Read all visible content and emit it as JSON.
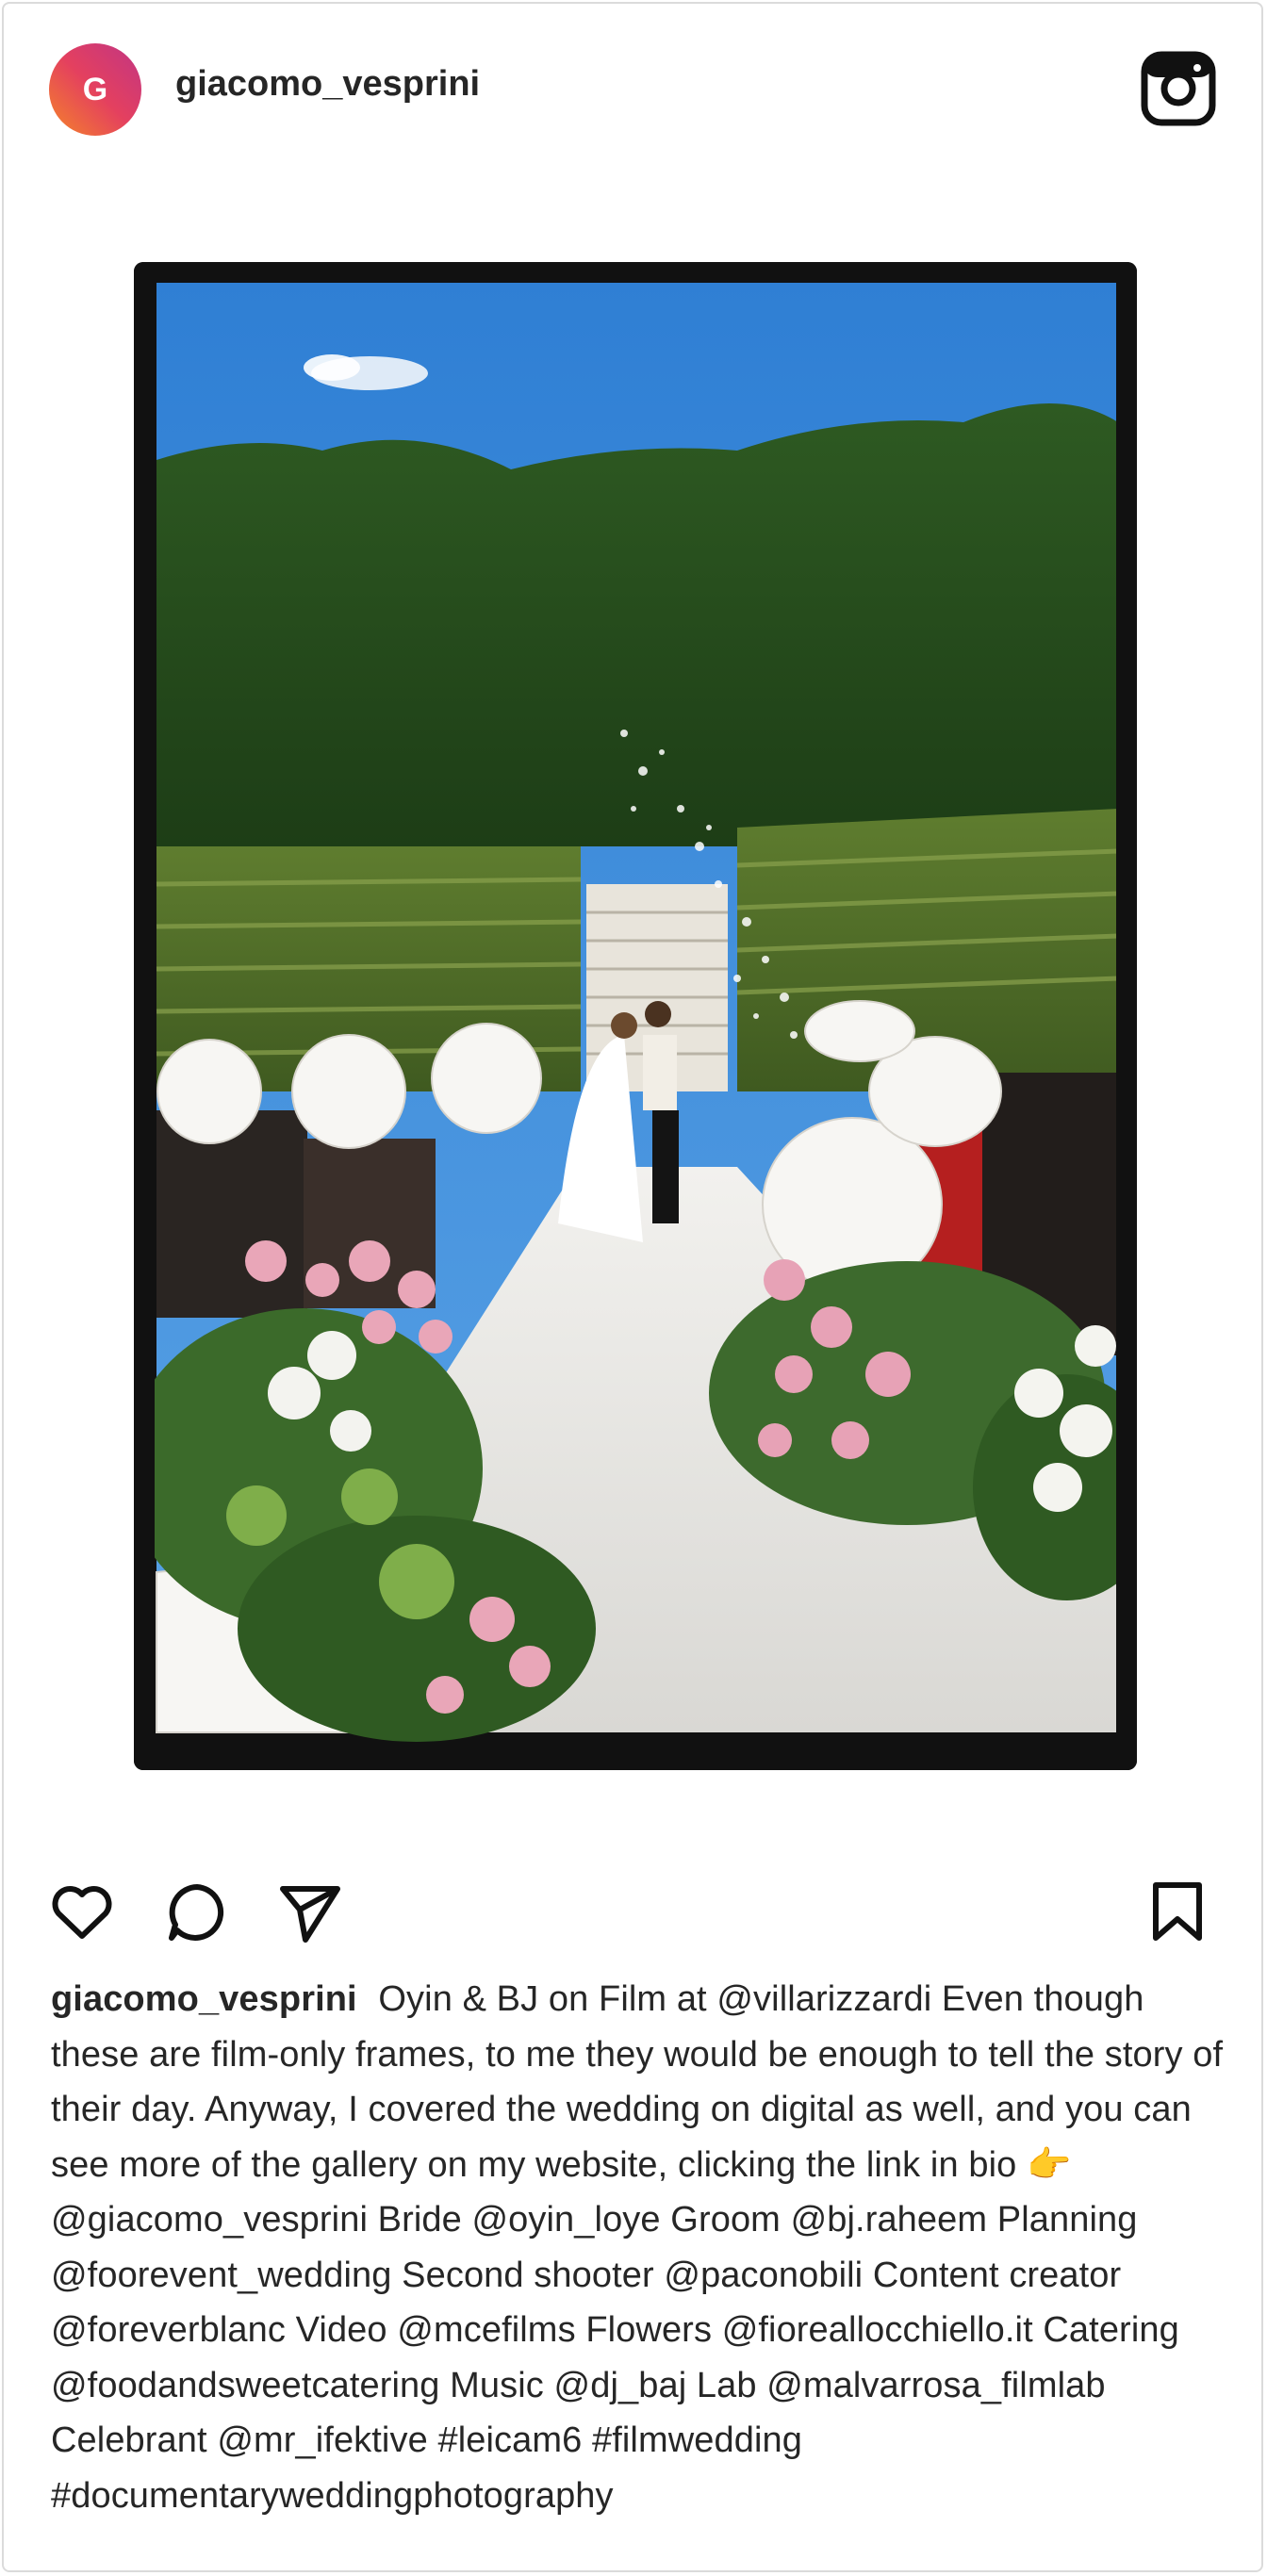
{
  "post": {
    "avatar_initial": "G",
    "username": "giacomo_vesprini"
  },
  "icons": {
    "logo": "instagram-icon",
    "like": "heart-icon",
    "comment": "comment-icon",
    "share": "send-icon",
    "save": "bookmark-icon"
  },
  "photo": {
    "description_hidden": true
  },
  "caption": {
    "username": "giacomo_vesprini",
    "text": "Oyin & BJ on Film at @villarizzardi Even though these are film-only frames, to me they would be enough to tell the story of their day. Anyway, I covered the wedding on digital as well, and you can see more of the gallery on my website, clicking the link in bio 👉 @giacomo_vesprini Bride @oyin_loye Groom @bj.raheem Planning @foorevent_wedding Second shooter @paconobili Content creator @foreverblanc Video @mcefilms Flowers @fioreallocchiello.it Catering @foodandsweetcatering Music @dj_baj Lab @malvarrosa_filmlab Celebrant @mr_ifektive #leicam6 #filmwedding #documentaryweddingphotography"
  },
  "colors": {
    "text": "#262626",
    "border": "#dbdbdb",
    "avatar_gradient": [
      "#f58529",
      "#e4405f",
      "#c13584"
    ]
  }
}
